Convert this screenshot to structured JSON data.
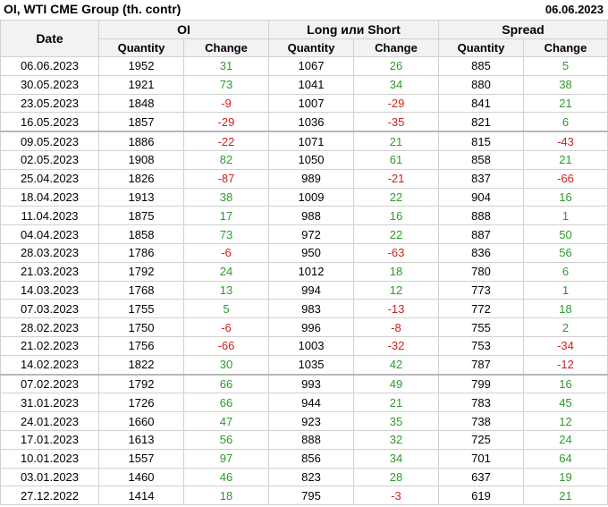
{
  "header": {
    "title": "OI, WTI CME Group (th. contr)",
    "date": "06.06.2023"
  },
  "columns": {
    "date": "Date",
    "groups": [
      "OI",
      "Long или Short",
      "Spread"
    ],
    "quantity": "Quantity",
    "change": "Change"
  },
  "colors": {
    "positive": "#2e9a2e",
    "negative": "#d22020"
  },
  "rows": [
    {
      "date": "06.06.2023",
      "oi_q": "1952",
      "oi_c": "31",
      "ls_q": "1067",
      "ls_c": "26",
      "sp_q": "885",
      "sp_c": "5"
    },
    {
      "date": "30.05.2023",
      "oi_q": "1921",
      "oi_c": "73",
      "ls_q": "1041",
      "ls_c": "34",
      "sp_q": "880",
      "sp_c": "38"
    },
    {
      "date": "23.05.2023",
      "oi_q": "1848",
      "oi_c": "-9",
      "ls_q": "1007",
      "ls_c": "-29",
      "sp_q": "841",
      "sp_c": "21"
    },
    {
      "date": "16.05.2023",
      "oi_q": "1857",
      "oi_c": "-29",
      "ls_q": "1036",
      "ls_c": "-35",
      "sp_q": "821",
      "sp_c": "6"
    },
    {
      "date": "09.05.2023",
      "oi_q": "1886",
      "oi_c": "-22",
      "ls_q": "1071",
      "ls_c": "21",
      "sp_q": "815",
      "sp_c": "-43"
    },
    {
      "date": "02.05.2023",
      "oi_q": "1908",
      "oi_c": "82",
      "ls_q": "1050",
      "ls_c": "61",
      "sp_q": "858",
      "sp_c": "21"
    },
    {
      "date": "25.04.2023",
      "oi_q": "1826",
      "oi_c": "-87",
      "ls_q": "989",
      "ls_c": "-21",
      "sp_q": "837",
      "sp_c": "-66"
    },
    {
      "date": "18.04.2023",
      "oi_q": "1913",
      "oi_c": "38",
      "ls_q": "1009",
      "ls_c": "22",
      "sp_q": "904",
      "sp_c": "16"
    },
    {
      "date": "11.04.2023",
      "oi_q": "1875",
      "oi_c": "17",
      "ls_q": "988",
      "ls_c": "16",
      "sp_q": "888",
      "sp_c": "1"
    },
    {
      "date": "04.04.2023",
      "oi_q": "1858",
      "oi_c": "73",
      "ls_q": "972",
      "ls_c": "22",
      "sp_q": "887",
      "sp_c": "50"
    },
    {
      "date": "28.03.2023",
      "oi_q": "1786",
      "oi_c": "-6",
      "ls_q": "950",
      "ls_c": "-63",
      "sp_q": "836",
      "sp_c": "56"
    },
    {
      "date": "21.03.2023",
      "oi_q": "1792",
      "oi_c": "24",
      "ls_q": "1012",
      "ls_c": "18",
      "sp_q": "780",
      "sp_c": "6"
    },
    {
      "date": "14.03.2023",
      "oi_q": "1768",
      "oi_c": "13",
      "ls_q": "994",
      "ls_c": "12",
      "sp_q": "773",
      "sp_c": "1"
    },
    {
      "date": "07.03.2023",
      "oi_q": "1755",
      "oi_c": "5",
      "ls_q": "983",
      "ls_c": "-13",
      "sp_q": "772",
      "sp_c": "18"
    },
    {
      "date": "28.02.2023",
      "oi_q": "1750",
      "oi_c": "-6",
      "ls_q": "996",
      "ls_c": "-8",
      "sp_q": "755",
      "sp_c": "2"
    },
    {
      "date": "21.02.2023",
      "oi_q": "1756",
      "oi_c": "-66",
      "ls_q": "1003",
      "ls_c": "-32",
      "sp_q": "753",
      "sp_c": "-34"
    },
    {
      "date": "14.02.2023",
      "oi_q": "1822",
      "oi_c": "30",
      "ls_q": "1035",
      "ls_c": "42",
      "sp_q": "787",
      "sp_c": "-12"
    },
    {
      "date": "07.02.2023",
      "oi_q": "1792",
      "oi_c": "66",
      "ls_q": "993",
      "ls_c": "49",
      "sp_q": "799",
      "sp_c": "16"
    },
    {
      "date": "31.01.2023",
      "oi_q": "1726",
      "oi_c": "66",
      "ls_q": "944",
      "ls_c": "21",
      "sp_q": "783",
      "sp_c": "45"
    },
    {
      "date": "24.01.2023",
      "oi_q": "1660",
      "oi_c": "47",
      "ls_q": "923",
      "ls_c": "35",
      "sp_q": "738",
      "sp_c": "12"
    },
    {
      "date": "17.01.2023",
      "oi_q": "1613",
      "oi_c": "56",
      "ls_q": "888",
      "ls_c": "32",
      "sp_q": "725",
      "sp_c": "24"
    },
    {
      "date": "10.01.2023",
      "oi_q": "1557",
      "oi_c": "97",
      "ls_q": "856",
      "ls_c": "34",
      "sp_q": "701",
      "sp_c": "64"
    },
    {
      "date": "03.01.2023",
      "oi_q": "1460",
      "oi_c": "46",
      "ls_q": "823",
      "ls_c": "28",
      "sp_q": "637",
      "sp_c": "19"
    },
    {
      "date": "27.12.2022",
      "oi_q": "1414",
      "oi_c": "18",
      "ls_q": "795",
      "ls_c": "-3",
      "sp_q": "619",
      "sp_c": "21"
    }
  ]
}
